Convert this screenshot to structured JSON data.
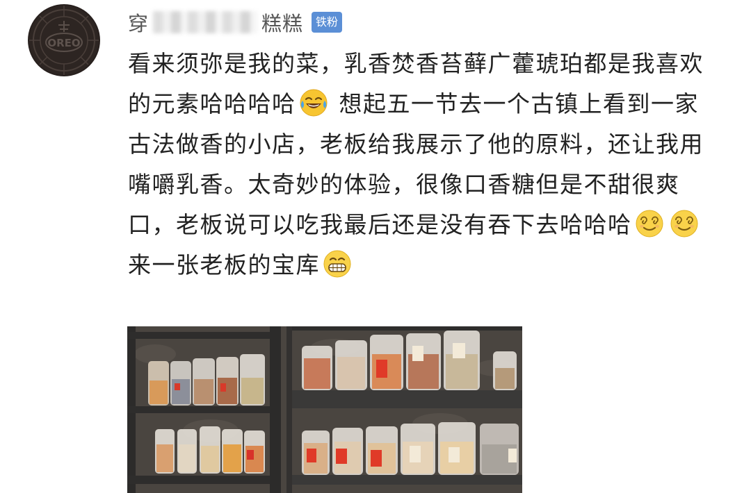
{
  "post": {
    "avatar_icon": "oreo-cookie-avatar",
    "username_prefix": "穿",
    "username_suffix": "糕糕",
    "badge": "铁粉",
    "segments": [
      "看来须弥是我的菜，乳香焚香苔藓广藿琥珀都是我喜欢的元素哈哈哈哈",
      " 想起五一节去一个古镇上看到一家古法做香的小店，老板给我展示了他的原料，还让我用嘴嚼乳香。太奇妙的体验，很像口香糖但是不甜很爽口，老板说可以吃我最后还是没有吞下去哈哈哈",
      "来一张老板的宝库"
    ],
    "emoji_names": [
      "tears-of-joy-emoji",
      "dizzy-smile-emoji",
      "grin-emoji"
    ],
    "oreo_text": "OREO"
  },
  "colors": {
    "badge": "#5b8fd6",
    "text": "#222222",
    "username": "#555555"
  }
}
